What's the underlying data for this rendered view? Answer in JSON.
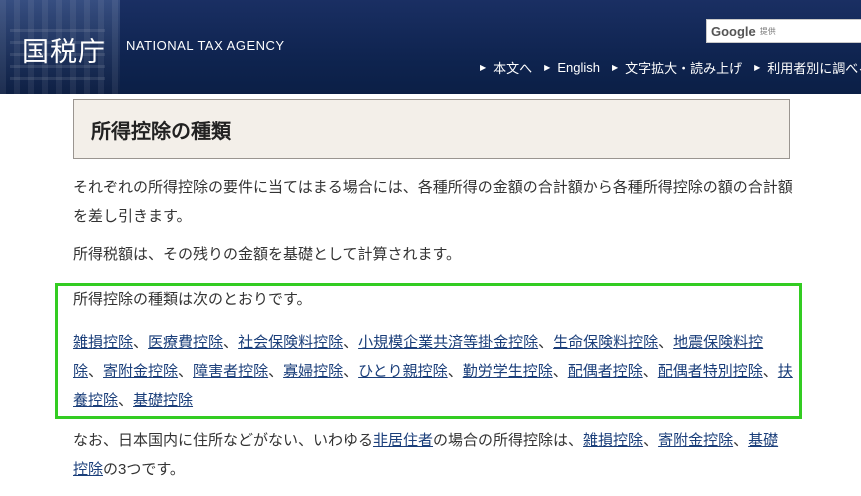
{
  "header": {
    "logo_jp": "国税庁",
    "logo_en": "NATIONAL TAX AGENCY",
    "search": {
      "brand": "Google",
      "sub": "提供"
    },
    "nav": [
      {
        "label": "本文へ"
      },
      {
        "label": "English"
      },
      {
        "label": "文字拡大・読み上げ"
      },
      {
        "label": "利用者別に調べる"
      }
    ]
  },
  "main": {
    "title": "所得控除の種類",
    "para1": "それぞれの所得控除の要件に当てはまる場合には、各種所得の金額の合計額から各種所得控除の額の合計額を差し引きます。",
    "para2": "所得税額は、その残りの金額を基礎として計算されます。",
    "para3": "所得控除の種類は次のとおりです。",
    "deductions": [
      "雑損控除",
      "医療費控除",
      "社会保険料控除",
      "小規模企業共済等掛金控除",
      "生命保険料控除",
      "地震保険料控除",
      "寄附金控除",
      "障害者控除",
      "寡婦控除",
      "ひとり親控除",
      "勤労学生控除",
      "配偶者控除",
      "配偶者特別控除",
      "扶養控除",
      "基礎控除"
    ],
    "separator": "、",
    "para4": {
      "prefix": "なお、日本国内に住所などがない、いわゆる",
      "link_nonresident": "非居住者",
      "mid": "の場合の所得控除は、",
      "link1": "雑損控除",
      "sep1": "、",
      "link2": "寄附金控除",
      "sep2": "、",
      "link3": "基礎控除",
      "suffix": "の3つです。"
    }
  }
}
